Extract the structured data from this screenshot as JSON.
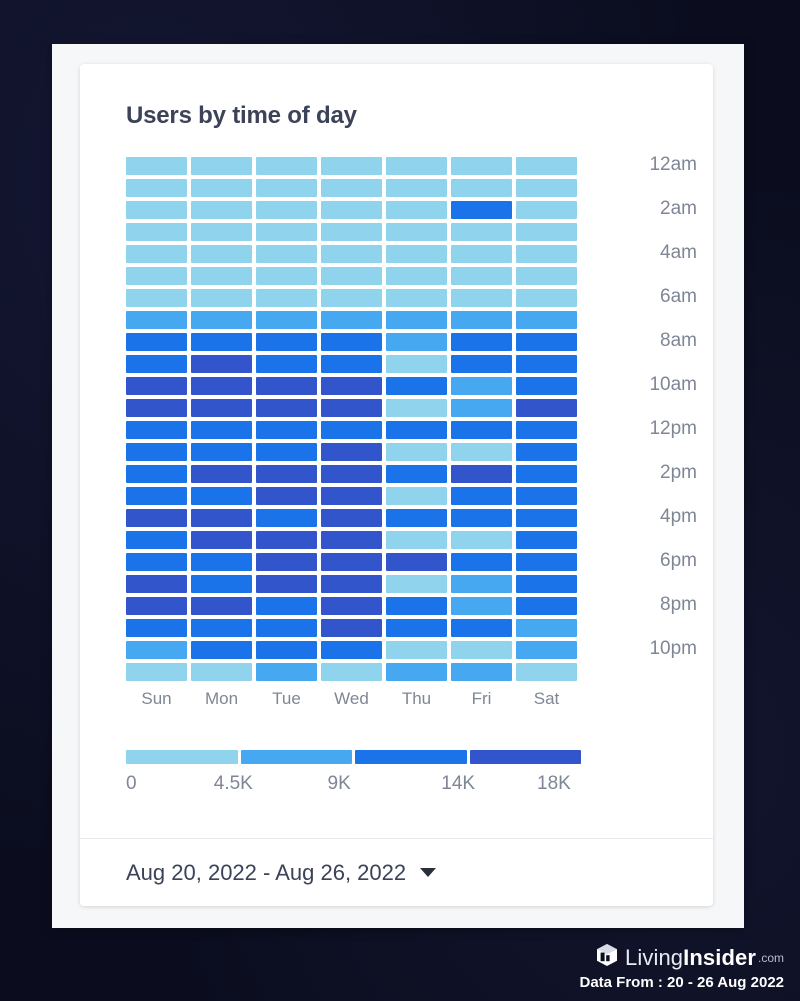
{
  "card": {
    "title": "Users by time of day",
    "footer": {
      "date_range": "Aug 20, 2022 - Aug 26, 2022",
      "caret_icon": "chevron-down-icon"
    }
  },
  "watermark": {
    "logo_icon": "livinginsider-cube-logo",
    "brand_part1": "Living",
    "brand_part2": "Insider",
    "brand_tld": ".com",
    "data_from": "Data From : 20 - 26  Aug 2022"
  },
  "chart_data": {
    "type": "heatmap",
    "title": "Users by time of day",
    "xlabel": "",
    "ylabel": "",
    "grid": false,
    "legend_position": "bottom",
    "categories": [
      "Sun",
      "Mon",
      "Tue",
      "Wed",
      "Thu",
      "Fri",
      "Sat"
    ],
    "rows": [
      "12am",
      "1am",
      "2am",
      "3am",
      "4am",
      "5am",
      "6am",
      "7am",
      "8am",
      "9am",
      "10am",
      "11am",
      "12pm",
      "1pm",
      "2pm",
      "3pm",
      "4pm",
      "5pm",
      "6pm",
      "7pm",
      "8pm",
      "9pm",
      "10pm",
      "11pm"
    ],
    "row_tick_labels": [
      "12am",
      "",
      "2am",
      "",
      "4am",
      "",
      "6am",
      "",
      "8am",
      "",
      "10am",
      "",
      "12pm",
      "",
      "2pm",
      "",
      "4pm",
      "",
      "6pm",
      "",
      "8pm",
      "",
      "10pm",
      ""
    ],
    "legend": {
      "tick_labels": [
        "0",
        "4.5K",
        "9K",
        "14K",
        "18K"
      ],
      "tick_values": [
        0,
        4500,
        9000,
        14000,
        18000
      ],
      "bands": [
        {
          "level": 1,
          "color": "#8fd3ec",
          "range": [
            0,
            4500
          ]
        },
        {
          "level": 2,
          "color": "#45a8f0",
          "range": [
            4500,
            9000
          ]
        },
        {
          "level": 3,
          "color": "#1a73e8",
          "range": [
            9000,
            14000
          ]
        },
        {
          "level": 4,
          "color": "#3355cc",
          "range": [
            14000,
            18000
          ]
        }
      ]
    },
    "values": [
      [
        1,
        1,
        1,
        1,
        1,
        1,
        1
      ],
      [
        1,
        1,
        1,
        1,
        1,
        1,
        1
      ],
      [
        1,
        1,
        1,
        1,
        1,
        3,
        1
      ],
      [
        1,
        1,
        1,
        1,
        1,
        1,
        1
      ],
      [
        1,
        1,
        1,
        1,
        1,
        1,
        1
      ],
      [
        1,
        1,
        1,
        1,
        1,
        1,
        1
      ],
      [
        1,
        1,
        1,
        1,
        1,
        1,
        1
      ],
      [
        2,
        2,
        2,
        2,
        2,
        2,
        2
      ],
      [
        3,
        3,
        3,
        3,
        2,
        3,
        3
      ],
      [
        3,
        4,
        3,
        3,
        1,
        3,
        3
      ],
      [
        4,
        4,
        4,
        4,
        3,
        2,
        3
      ],
      [
        4,
        4,
        4,
        4,
        1,
        2,
        4
      ],
      [
        3,
        3,
        3,
        3,
        3,
        3,
        3
      ],
      [
        3,
        3,
        3,
        4,
        1,
        1,
        3
      ],
      [
        3,
        4,
        4,
        4,
        3,
        4,
        3
      ],
      [
        3,
        3,
        4,
        4,
        1,
        3,
        3
      ],
      [
        4,
        4,
        3,
        4,
        3,
        3,
        3
      ],
      [
        3,
        4,
        4,
        4,
        1,
        1,
        3
      ],
      [
        3,
        3,
        4,
        4,
        4,
        3,
        3
      ],
      [
        4,
        3,
        4,
        4,
        1,
        2,
        3
      ],
      [
        4,
        4,
        3,
        4,
        3,
        2,
        3
      ],
      [
        3,
        3,
        3,
        4,
        3,
        3,
        2
      ],
      [
        2,
        3,
        3,
        3,
        1,
        1,
        2
      ],
      [
        1,
        1,
        2,
        1,
        2,
        2,
        1
      ]
    ]
  }
}
